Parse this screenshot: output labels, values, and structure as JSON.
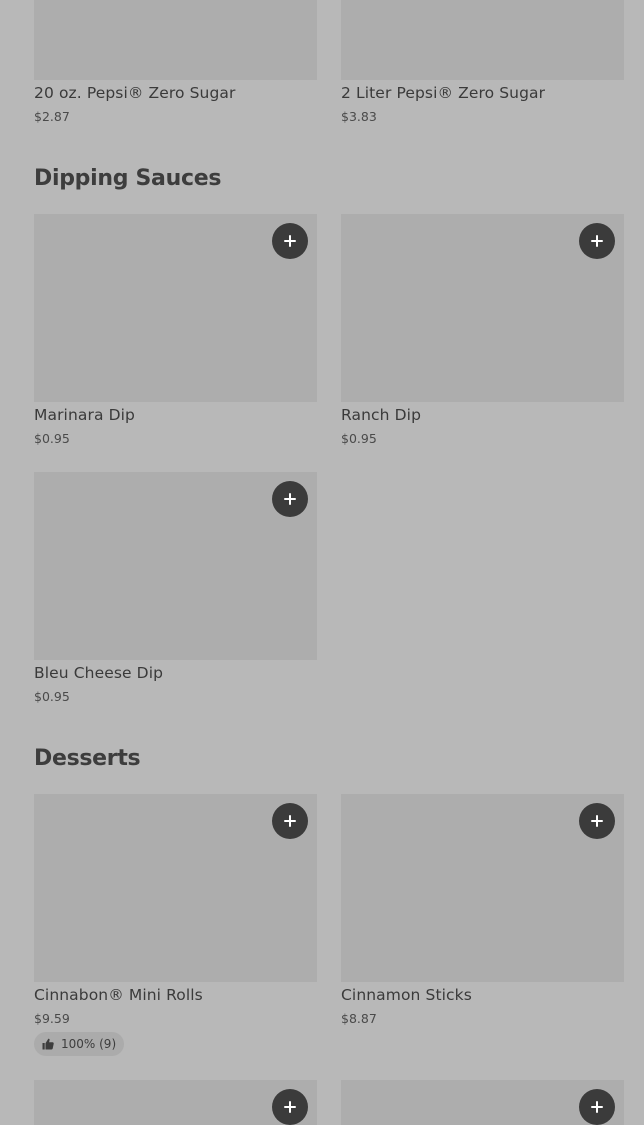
{
  "sections": [
    {
      "key": "drinks-partial",
      "items": [
        {
          "name": "20 oz. Pepsi® Zero Sugar",
          "price": "$2.87"
        },
        {
          "name": "2 Liter Pepsi® Zero Sugar",
          "price": "$3.83"
        }
      ]
    },
    {
      "key": "dipping-sauces",
      "title": "Dipping Sauces",
      "items": [
        {
          "name": "Marinara Dip",
          "price": "$0.95"
        },
        {
          "name": "Ranch Dip",
          "price": "$0.95"
        },
        {
          "name": "Bleu Cheese Dip",
          "price": "$0.95"
        }
      ]
    },
    {
      "key": "desserts",
      "title": "Desserts",
      "items": [
        {
          "name": "Cinnabon® Mini Rolls",
          "price": "$9.59",
          "rating": "100% (9)"
        },
        {
          "name": "Cinnamon Sticks",
          "price": "$8.87"
        }
      ]
    }
  ],
  "icons": {
    "add": "plus-icon",
    "rating": "thumbs-up-icon"
  },
  "colors": {
    "background": "#b8b8b8",
    "image_placeholder": "#adadad",
    "add_button": "#3b3b3b"
  }
}
